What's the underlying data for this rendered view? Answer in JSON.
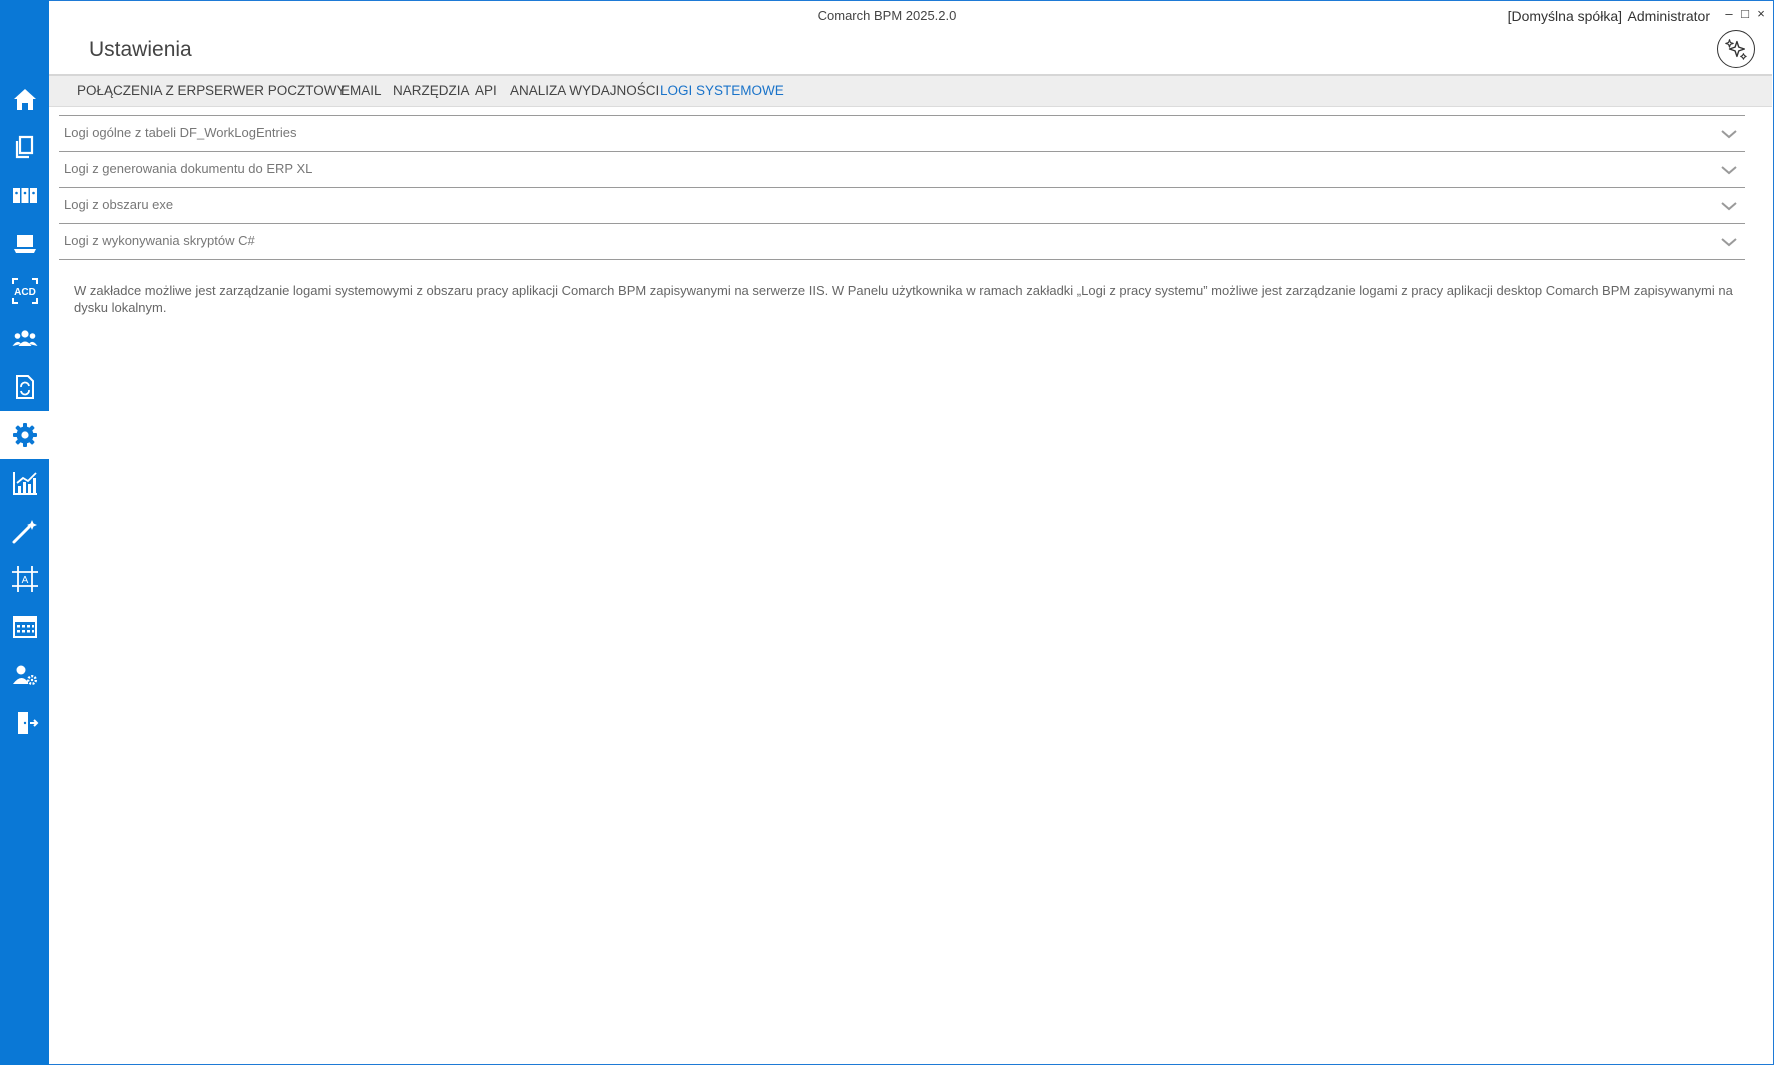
{
  "window": {
    "app_title": "Comarch BPM 2025.2.0",
    "company": "[Domyślna spółka]",
    "user": "Administrator",
    "minimize": "–",
    "maximize": "□",
    "close": "×"
  },
  "page": {
    "title": "Ustawienia"
  },
  "sidebar": {
    "accent_color": "#0a78d6",
    "items": [
      {
        "icon": "home-icon"
      },
      {
        "icon": "documents-icon"
      },
      {
        "icon": "binders-icon"
      },
      {
        "icon": "laptop-icon"
      },
      {
        "icon": "acd-scan-icon",
        "label": "ACD"
      },
      {
        "icon": "users-icon"
      },
      {
        "icon": "document-sync-icon"
      },
      {
        "icon": "gear-icon",
        "active": true
      },
      {
        "icon": "chart-icon"
      },
      {
        "icon": "magic-wand-icon"
      },
      {
        "icon": "designer-icon",
        "label": "A"
      },
      {
        "icon": "calendar-icon"
      },
      {
        "icon": "user-settings-icon"
      },
      {
        "icon": "logout-icon"
      }
    ]
  },
  "tabs": [
    {
      "label": "POŁĄCZENIA Z ERP",
      "active": false
    },
    {
      "label": "SERWER POCZTOWY",
      "active": false
    },
    {
      "label": "EMAIL",
      "active": false
    },
    {
      "label": "NARZĘDZIA",
      "active": false
    },
    {
      "label": "API",
      "active": false
    },
    {
      "label": "ANALIZA WYDAJNOŚCI",
      "active": false
    },
    {
      "label": "LOGI SYSTEMOWE",
      "active": true
    }
  ],
  "sections": [
    {
      "label": "Logi ogólne z tabeli DF_WorkLogEntries"
    },
    {
      "label": "Logi z generowania dokumentu do ERP XL"
    },
    {
      "label": "Logi z obszaru exe"
    },
    {
      "label": "Logi z wykonywania skryptów C#"
    }
  ],
  "info_text": "W zakładce możliwe jest zarządzanie logami systemowymi z obszaru pracy aplikacji Comarch BPM zapisywanymi na serwerze IIS. W Panelu użytkownika w ramach zakładki „Logi z pracy systemu” możliwe jest zarządzanie logami z pracy aplikacji desktop Comarch BPM zapisywanymi na dysku lokalnym."
}
